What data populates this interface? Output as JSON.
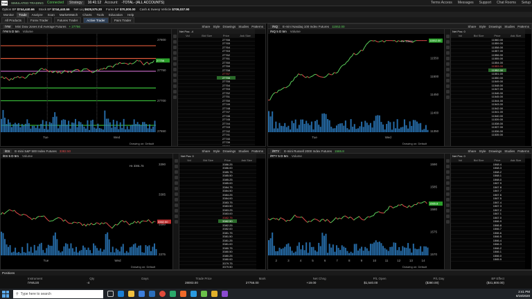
{
  "app": {
    "logo": "TOS",
    "mode": "SIMULATED TRADING",
    "status": "Connected",
    "symbol_field": "Strategy",
    "time": "16:41:12",
    "account_label": "Account:",
    "account_value": "-TOTAL- (ALL ACCOUNTS)",
    "top_right": [
      "Terms Access",
      "Messages",
      "Support",
      "Chat Rooms",
      "Setup"
    ]
  },
  "balances": [
    {
      "label": "Option BP",
      "value": "$744,440.66"
    },
    {
      "label": "Stock BP",
      "value": "$744,440.66"
    },
    {
      "label": "Net Liq",
      "value": "$628,575.30"
    },
    {
      "label": "Forex BP",
      "value": "$70,000.00"
    },
    {
      "label": "Cash & Sweep Vehicle",
      "value": "$709,037.90"
    }
  ],
  "main_tabs": [
    "Monitor",
    "Trade",
    "Analyze",
    "Scan",
    "MarketWatch",
    "Charts",
    "Tools",
    "Education",
    "Help"
  ],
  "main_tab_active": "Trade",
  "sub_tabs": [
    "All Products",
    "Forex Trader",
    "Futures Trader",
    "Active Trader",
    "Pairs Trader"
  ],
  "sub_tab_active": "Active Trader",
  "toolbar": {
    "share": "Share",
    "style": "Style",
    "drawings": "Drawings",
    "studies": "Studies",
    "patterns": "Patterns",
    "drawing_on": "Drawing on: Default",
    "volume": "Volume"
  },
  "quads": [
    {
      "symbol": "/YM",
      "desc": "Mini Dow Jones Ind Average Futures",
      "change": "+ 27756",
      "chg_class": "up",
      "agg": "/YM 5 D 5m",
      "netpos": "Net Pos: -4",
      "x_labels": [
        "Tue",
        "Wed"
      ],
      "price_labels": [
        "27800",
        "27750",
        "27700",
        "27650"
      ],
      "flag": "27756"
    },
    {
      "symbol": "/NQ",
      "desc": "E-mini Nasdaq 100 Index Futures",
      "change": "11552.00",
      "chg_class": "up",
      "agg": "/NQ 5 D 5m",
      "netpos": "Net Pos: 0",
      "x_labels": [
        "Tue",
        "Wed"
      ],
      "price_labels": [
        "11600",
        "11550",
        "11500",
        "11450",
        "11400",
        "11350"
      ],
      "flag": "11552.00",
      "hi": "Hi: 11600"
    },
    {
      "symbol": "/ES",
      "desc": "E-mini S&P 500 Index Futures",
      "change": "3382.50",
      "chg_class": "dn",
      "agg": "/ES 5 D 5m",
      "netpos": "Net Pos: 0",
      "x_labels": [
        "Tue",
        "Wed"
      ],
      "price_labels": [
        "3390",
        "3385",
        "3380",
        "3375"
      ],
      "flag": "3382.50",
      "hi": "Hi: 3391.75"
    },
    {
      "symbol": "/RTY",
      "desc": "E-mini Russell 2000 Index Futures",
      "change": "1565.8",
      "chg_class": "up",
      "agg": "/RTY 5 D 5m",
      "netpos": "Net Pos: 0",
      "x_labels": [
        "2",
        "3",
        "4",
        "5",
        "6",
        "7",
        "8",
        "9",
        "10",
        "11",
        "12",
        "13",
        "14"
      ],
      "price_labels": [
        "1590",
        "1585",
        "1580",
        "1575",
        "1570"
      ],
      "flag": "1565.8"
    }
  ],
  "ladders": [
    {
      "title": "Net Pos: -4",
      "headers": [
        "Vol",
        "Bid Size",
        "Price",
        "Ask Size"
      ],
      "rows": [
        "27766",
        "27765",
        "27764",
        "27763",
        "27762",
        "27761",
        "27760",
        "27759",
        "27758",
        "27757",
        "27756",
        "27755",
        "27754",
        "27753",
        "27752",
        "27751",
        "27750",
        "27749",
        "27748",
        "27747",
        "27746",
        "27745",
        "27744",
        "27743",
        "27742",
        "27741",
        "27740",
        "27739",
        "27738",
        "27737",
        "27736"
      ],
      "cur": "27756"
    },
    {
      "title": "Net Pos: 0",
      "headers": [
        "Vol",
        "Bid Size",
        "Price",
        "Ask Size"
      ],
      "rows": [
        "11560.00",
        "11559.00",
        "11558.00",
        "11557.00",
        "11556.00",
        "11555.00",
        "11554.00",
        "11553.00",
        "11552.00",
        "11551.00",
        "11550.00",
        "11549.00",
        "11548.00",
        "11547.00",
        "11546.00",
        "11545.00",
        "11544.00",
        "11543.00",
        "11542.00",
        "11541.00",
        "11540.00",
        "11539.00",
        "11538.00",
        "11537.00",
        "11536.00",
        "11535.00"
      ],
      "cur": "11552.00"
    },
    {
      "title": "Net Pos: 0",
      "headers": [
        "Vol",
        "Bid Size",
        "Price",
        "Ask Size"
      ],
      "rows": [
        "3386.25",
        "3386.00",
        "3385.75",
        "3385.50",
        "3385.25",
        "3385.00",
        "3384.75",
        "3384.50",
        "3384.25",
        "3384.00",
        "3383.75",
        "3383.50",
        "3383.25",
        "3383.00",
        "3382.75",
        "3382.50",
        "3382.25",
        "3382.00",
        "3381.75",
        "3381.50",
        "3381.25",
        "3381.00",
        "3380.75",
        "3380.50",
        "3380.25",
        "3380.00",
        "3379.75",
        "3379.50",
        "3379.25",
        "3379.00"
      ],
      "cur": "3382.50"
    },
    {
      "title": "Net Pos: 0",
      "headers": [
        "Vol",
        "Bid Size",
        "Price",
        "Ask Size"
      ],
      "rows": [
        "1568.4",
        "1568.3",
        "1568.2",
        "1568.1",
        "1568.0",
        "1567.9",
        "1567.8",
        "1567.7",
        "1567.6",
        "1567.5",
        "1567.4",
        "1567.3",
        "1567.2",
        "1567.1",
        "1567.0",
        "1566.9",
        "1566.8",
        "1566.7",
        "1566.6",
        "1566.5",
        "1566.4",
        "1566.3",
        "1566.2",
        "1566.1",
        "1566.0",
        "1565.9"
      ],
      "cur": "1565.8"
    }
  ],
  "positions": {
    "title": "Positions",
    "cols": [
      "Instrument",
      "Qty",
      "Days",
      "Trade Price",
      "Mark",
      "Net Chng",
      "P/L Open",
      "P/L Day",
      "BP Effect"
    ],
    "vals": [
      "/YMU20",
      "-4",
      "",
      "28003.00",
      "27756.00",
      "+19.00",
      "$1,540.00",
      "($380.00)",
      "($41,800.00)"
    ]
  },
  "taskbar": {
    "search_placeholder": "Type here to search",
    "time": "2:41 PM",
    "date": "8/19/2020"
  },
  "colors": {
    "up": "#5dd35d",
    "down": "#e04a4a",
    "volume": "#2b7bbf",
    "accent": "#2d3e55"
  }
}
